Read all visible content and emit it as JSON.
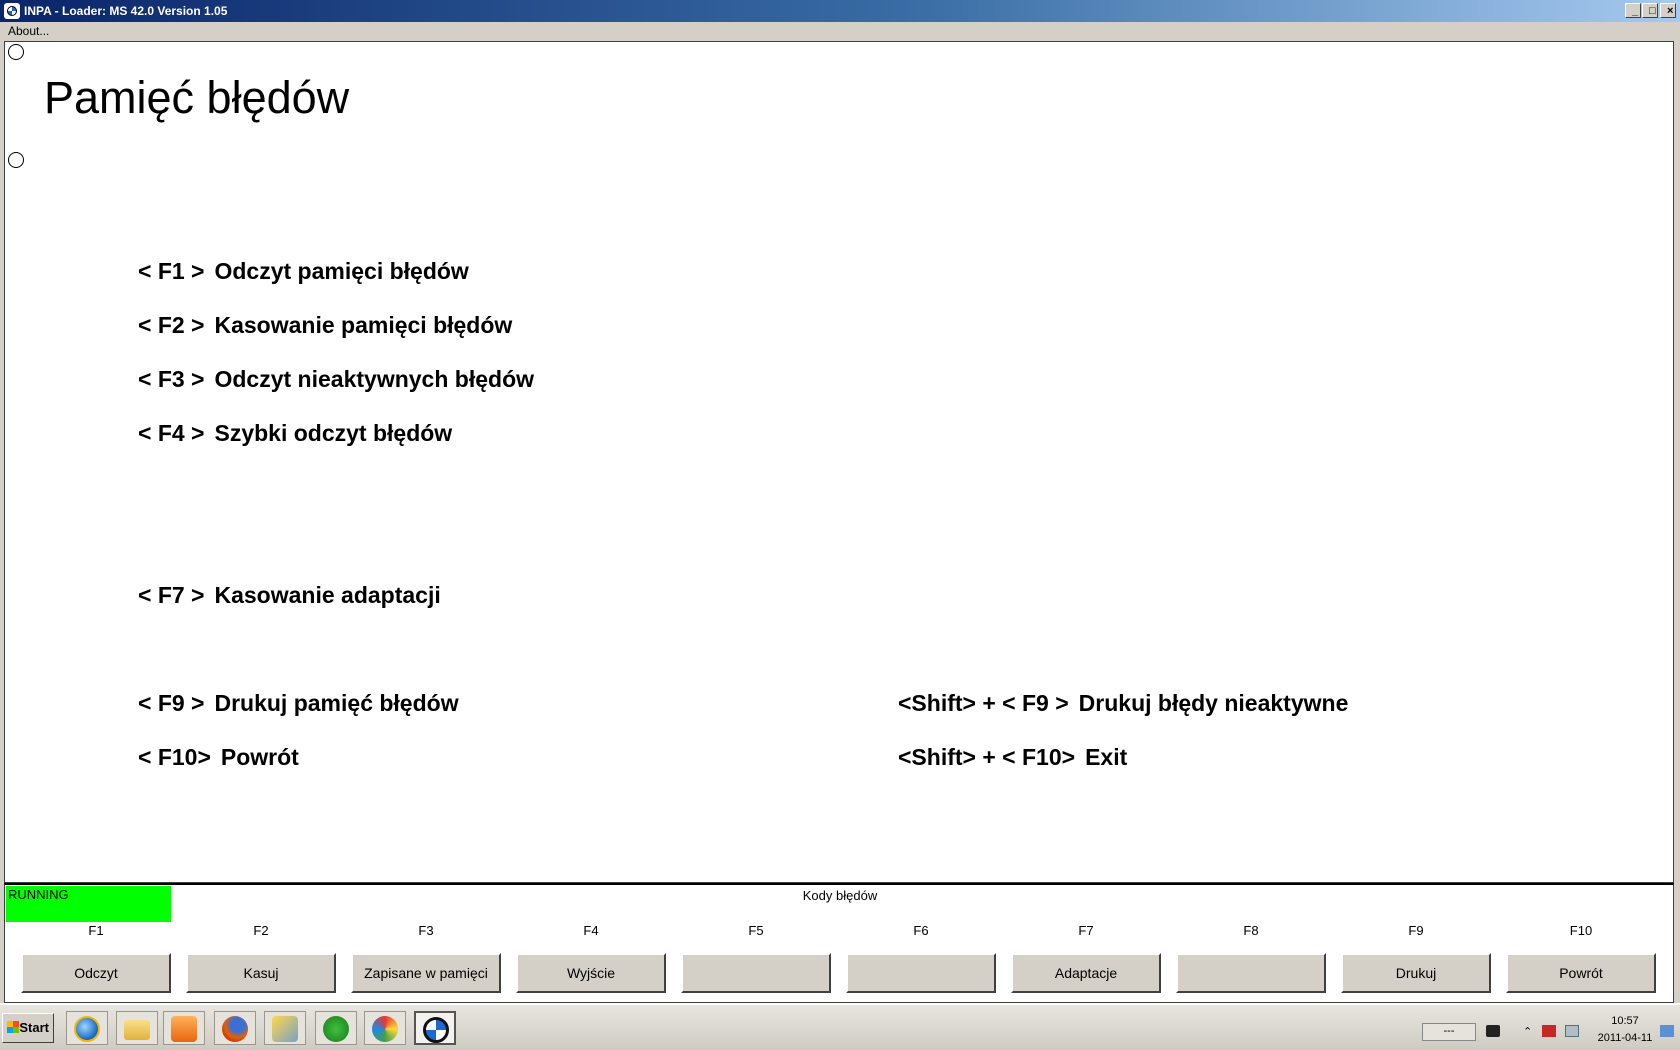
{
  "window": {
    "title": "INPA - Loader:  MS 42.0 Version 1.05",
    "controls": {
      "minimize": "_",
      "maximize": "□",
      "close": "×"
    }
  },
  "menubar": {
    "about_label": "About..."
  },
  "page": {
    "title": "Pamięć błędów",
    "menu": [
      {
        "key": "< F1 >",
        "desc": "Odczyt pamięci błędów"
      },
      {
        "key": "< F2 >",
        "desc": "Kasowanie pamięci błędów"
      },
      {
        "key": "< F3 >",
        "desc": "Odczyt nieaktywnych błędów"
      },
      {
        "key": "< F4 >",
        "desc": "Szybki odczyt błędów"
      },
      {
        "key": "< F7 >",
        "desc": "Kasowanie adaptacji"
      },
      {
        "key": "< F9 >",
        "desc": "Drukuj pamięć błędów"
      },
      {
        "key": "< F10>",
        "desc": "Powrót"
      }
    ],
    "shift_menu": [
      {
        "key": "<Shift> + < F9 >",
        "desc": "Drukuj błędy nieaktywne"
      },
      {
        "key": "<Shift> + < F10>",
        "desc": "Exit"
      }
    ]
  },
  "panel": {
    "status": "RUNNING",
    "status_color": "#00ff00",
    "caption": "Kody błędów",
    "fkeys": [
      {
        "key": "F1",
        "label": "Odczyt"
      },
      {
        "key": "F2",
        "label": "Kasuj"
      },
      {
        "key": "F3",
        "label": "Zapisane w pamięci"
      },
      {
        "key": "F4",
        "label": "Wyjście"
      },
      {
        "key": "F5",
        "label": ""
      },
      {
        "key": "F6",
        "label": ""
      },
      {
        "key": "F7",
        "label": "Adaptacje"
      },
      {
        "key": "F8",
        "label": ""
      },
      {
        "key": "F9",
        "label": "Drukuj"
      },
      {
        "key": "F10",
        "label": "Powrót"
      }
    ]
  },
  "taskbar": {
    "start_label": "Start",
    "apps": [
      "internet-explorer-icon",
      "folder-icon",
      "media-player-icon",
      "firefox-icon",
      "hxd-icon",
      "ediabas-icon",
      "paint-icon",
      "bmw-icon"
    ],
    "tray_input": "---",
    "clock_time": "10:57",
    "clock_date": "2011-04-11"
  }
}
